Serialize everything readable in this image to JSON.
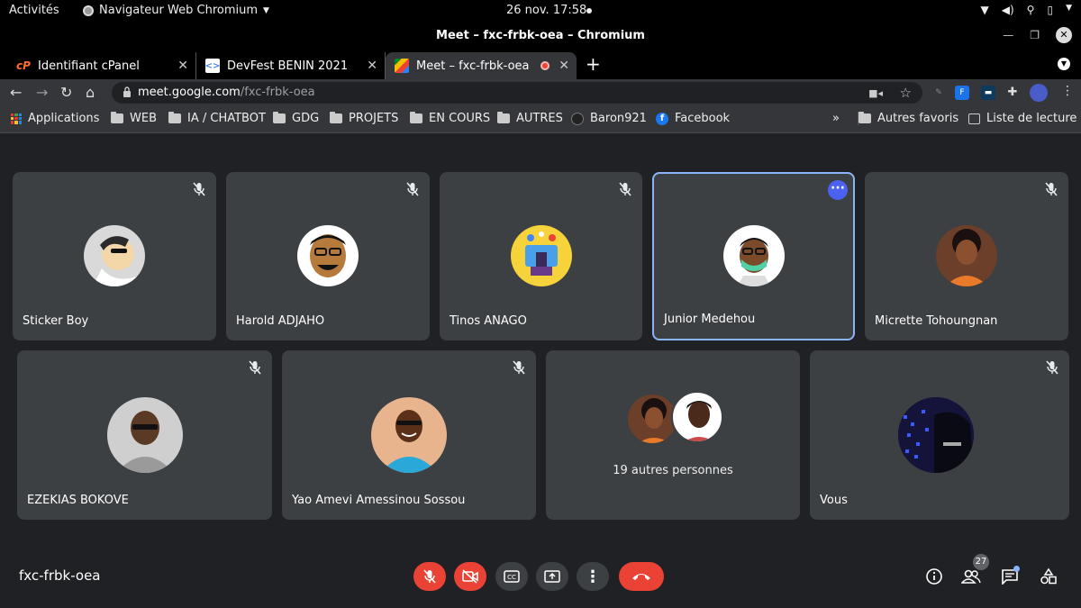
{
  "system": {
    "activities": "Activités",
    "app_name": "Navigateur Web Chromium",
    "clock": "26 nov.  17:58"
  },
  "window": {
    "title": "Meet – fxc-frbk-oea – Chromium"
  },
  "tabs": [
    {
      "label": "Identifiant cPanel",
      "favicon": "cpanel-icon"
    },
    {
      "label": "DevFest BENIN 2021",
      "favicon": "devfest-icon"
    },
    {
      "label": "Meet – fxc-frbk-oea",
      "favicon": "meet-icon",
      "active": true
    }
  ],
  "address_bar": {
    "host": "meet.google.com",
    "path": "/fxc-frbk-oea"
  },
  "bookmarks": [
    {
      "label": "Applications",
      "icon": "apps-grid-icon"
    },
    {
      "label": "WEB",
      "icon": "folder-icon"
    },
    {
      "label": "IA / CHATBOT",
      "icon": "folder-icon"
    },
    {
      "label": "GDG",
      "icon": "folder-icon"
    },
    {
      "label": "PROJETS",
      "icon": "folder-icon"
    },
    {
      "label": "EN COURS",
      "icon": "folder-icon"
    },
    {
      "label": "AUTRES",
      "icon": "folder-icon"
    },
    {
      "label": "Baron921",
      "icon": "github-icon"
    },
    {
      "label": "Facebook",
      "icon": "facebook-icon"
    },
    {
      "label": "»",
      "icon": "overflow"
    },
    {
      "label": "Autres favoris",
      "icon": "folder-icon"
    },
    {
      "label": "Liste de lecture",
      "icon": "reading-list-icon"
    }
  ],
  "participants": [
    {
      "name": "Sticker Boy",
      "muted": true,
      "bg": "#d9d9d9"
    },
    {
      "name": "Harold ADJAHO",
      "muted": true,
      "bg": "#ffffff"
    },
    {
      "name": "Tinos ANAGO",
      "muted": true,
      "bg": "#f6d33a"
    },
    {
      "name": "Junior Medehou",
      "muted": false,
      "speaking": true,
      "bg": "#ffffff"
    },
    {
      "name": "Micrette Tohoungnan",
      "muted": true,
      "bg": "#6b3f2a"
    },
    {
      "name": "EZEKIAS BOKOVE",
      "muted": true,
      "bg": "#cfcfcf"
    },
    {
      "name": "Yao Amevi Amessinou Sossou",
      "muted": true,
      "bg": "#e8b48e"
    },
    {
      "name": "",
      "others_text": "19 autres personnes",
      "muted": false
    },
    {
      "name": "Vous",
      "muted": true,
      "bg": "#1a1a40"
    }
  ],
  "meeting": {
    "code": "fxc-frbk-oea",
    "people_count": "27"
  },
  "colors": {
    "accent": "#8ab4f8",
    "danger": "#ea4335",
    "tile": "#3c4043",
    "background": "#202124"
  }
}
